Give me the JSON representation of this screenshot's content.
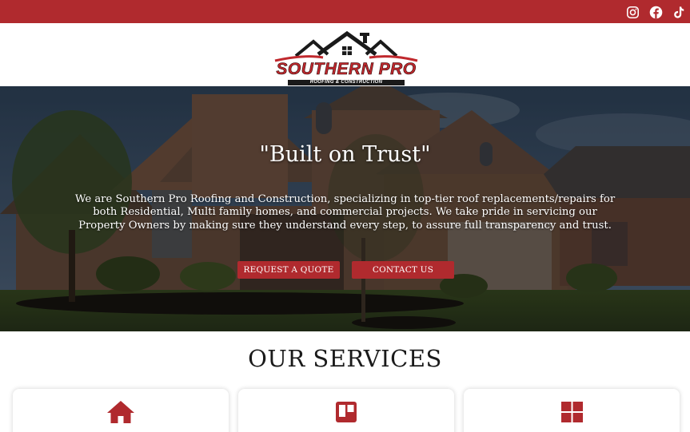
{
  "colors": {
    "brand_red": "#b02a2e",
    "white": "#ffffff",
    "dark_text": "#1a1a1a"
  },
  "topbar": {
    "social": [
      {
        "icon": "instagram-icon"
      },
      {
        "icon": "facebook-icon"
      },
      {
        "icon": "tiktok-icon"
      }
    ]
  },
  "logo": {
    "name": "SOUTHERN PRO",
    "tagline": "ROOFING & CONSTRUCTION"
  },
  "hero": {
    "title": "\"Built on Trust\"",
    "description": "We are Southern Pro Roofing and Construction, specializing in top-tier roof replacements/repairs for both Residential, Multi family homes, and commercial projects. We take pride in servicing our Property Owners by making sure they understand every step, to assure full transparency and trust.",
    "buttons": {
      "quote": "REQUEST A QUOTE",
      "contact": "CONTACT US"
    }
  },
  "services": {
    "title": "OUR SERVICES",
    "cards": [
      {
        "icon": "home-icon"
      },
      {
        "icon": "board-icon"
      },
      {
        "icon": "grid-icon"
      }
    ]
  }
}
